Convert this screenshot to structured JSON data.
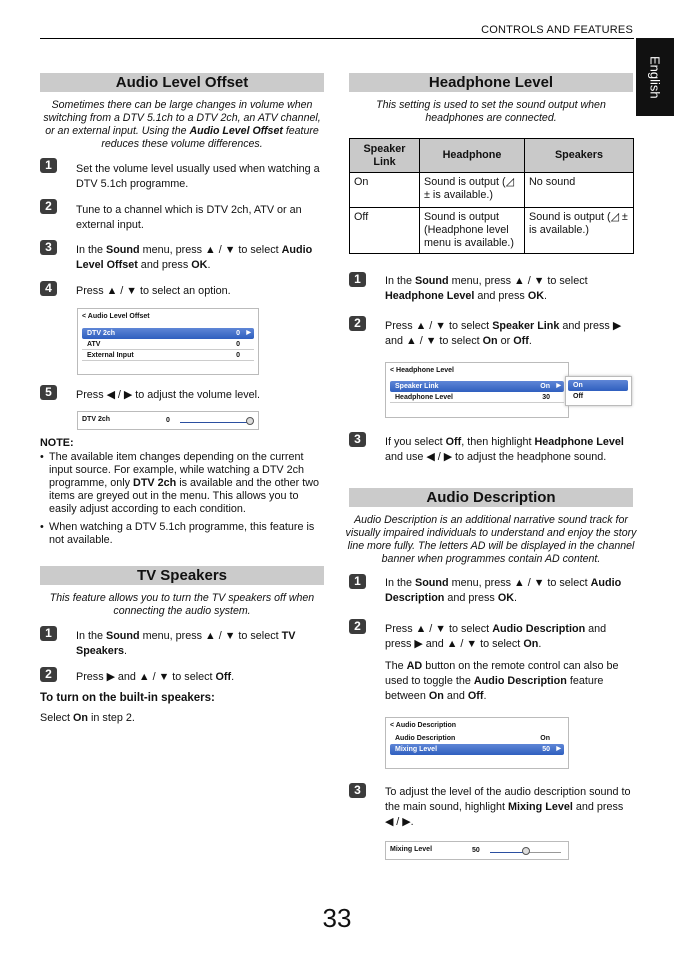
{
  "header": {
    "section": "CONTROLS AND FEATURES",
    "language_tab": "English",
    "page_number": "33"
  },
  "audio_level_offset": {
    "title": "Audio Level Offset",
    "intro": [
      {
        "t": "Sometimes there can be large changes in volume when switching from a DTV 5.1ch to a DTV 2ch, an ATV channel, or an external input. Using the "
      },
      {
        "t": "Audio Level Offset",
        "b": true
      },
      {
        "t": " feature reduces these volume differences."
      }
    ],
    "steps": [
      {
        "n": "1",
        "text": [
          {
            "t": "Set the volume level usually used when watching a DTV 5.1ch programme."
          }
        ]
      },
      {
        "n": "2",
        "text": [
          {
            "t": "Tune to a channel which is DTV 2ch, ATV or an external input."
          }
        ]
      },
      {
        "n": "3",
        "text": [
          {
            "t": "In the "
          },
          {
            "t": "Sound",
            "b": true
          },
          {
            "t": " menu, press ▲ / ▼ to select "
          },
          {
            "t": "Audio Level Offset",
            "b": true
          },
          {
            "t": " and press "
          },
          {
            "t": "OK",
            "b": true
          },
          {
            "t": "."
          }
        ]
      },
      {
        "n": "4",
        "text": [
          {
            "t": "Press ▲ / ▼ to select an option."
          }
        ]
      },
      {
        "n": "5",
        "text": [
          {
            "t": "Press ◀ / ▶ to adjust the volume level."
          }
        ]
      }
    ],
    "menu": {
      "title": "< Audio Level Offset",
      "items": [
        {
          "label": "DTV 2ch",
          "value": "0",
          "selected": true
        },
        {
          "label": "ATV",
          "value": "0"
        },
        {
          "label": "External Input",
          "value": "0"
        }
      ]
    },
    "slider": {
      "label": "DTV 2ch",
      "value": "0",
      "level_percent": 100
    },
    "note_title": "NOTE:",
    "notes": [
      [
        {
          "t": "The available item changes depending on the current input source. For example, while watching a DTV 2ch programme, only "
        },
        {
          "t": "DTV 2ch",
          "b": true
        },
        {
          "t": " is available and the other two items are greyed out in the menu. This allows you to easily adjust according to each condition."
        }
      ],
      [
        {
          "t": "When watching a DTV 5.1ch programme, this feature is not available."
        }
      ]
    ]
  },
  "tv_speakers": {
    "title": "TV Speakers",
    "intro": [
      {
        "t": "This feature allows you to turn the TV speakers off when connecting the audio system."
      }
    ],
    "steps": [
      {
        "n": "1",
        "text": [
          {
            "t": "In the "
          },
          {
            "t": "Sound",
            "b": true
          },
          {
            "t": " menu, press ▲ / ▼ to select "
          },
          {
            "t": "TV Speakers",
            "b": true
          },
          {
            "t": "."
          }
        ]
      },
      {
        "n": "2",
        "text": [
          {
            "t": "Press ▶ and ▲ / ▼ to select "
          },
          {
            "t": "Off",
            "b": true
          },
          {
            "t": "."
          }
        ]
      }
    ],
    "subheading": "To turn on the built-in speakers:",
    "subtext": [
      {
        "t": "Select "
      },
      {
        "t": "On",
        "b": true
      },
      {
        "t": " in step 2."
      }
    ]
  },
  "headphone_level": {
    "title": "Headphone Level",
    "intro": [
      {
        "t": "This setting is used to set the sound output when headphones are connected."
      }
    ],
    "table": {
      "headers": [
        "Speaker Link",
        "Headphone",
        "Speakers"
      ],
      "rows": [
        [
          "On",
          " Sound is output (◿ ± is available.)",
          "No sound"
        ],
        [
          "Off",
          "Sound is output (Headphone level menu is available.)",
          "Sound is output (◿ ± is available.)"
        ]
      ]
    },
    "steps": [
      {
        "n": "1",
        "text": [
          {
            "t": "In the "
          },
          {
            "t": "Sound",
            "b": true
          },
          {
            "t": " menu, press ▲ / ▼ to select "
          },
          {
            "t": "Headphone Level",
            "b": true
          },
          {
            "t": " and press "
          },
          {
            "t": "OK",
            "b": true
          },
          {
            "t": "."
          }
        ]
      },
      {
        "n": "2",
        "text": [
          {
            "t": "Press ▲ / ▼ to select "
          },
          {
            "t": "Speaker Link",
            "b": true
          },
          {
            "t": " and press ▶ and ▲ / ▼ to select "
          },
          {
            "t": "On",
            "b": true
          },
          {
            "t": " or "
          },
          {
            "t": "Off",
            "b": true
          },
          {
            "t": "."
          }
        ]
      },
      {
        "n": "3",
        "text": [
          {
            "t": "If you select "
          },
          {
            "t": "Off",
            "b": true
          },
          {
            "t": ", then highlight "
          },
          {
            "t": "Headphone Level",
            "b": true
          },
          {
            "t": " and use ◀ / ▶ to adjust the headphone sound."
          }
        ]
      }
    ],
    "menu": {
      "title": "< Headphone Level",
      "items": [
        {
          "label": "Speaker Link",
          "value": "On",
          "selected": true
        },
        {
          "label": "Headphone Level",
          "value": "30"
        }
      ],
      "popup": [
        "On",
        "Off"
      ]
    }
  },
  "audio_description": {
    "title": "Audio Description",
    "intro": [
      {
        "t": "Audio Description is an additional narrative sound track for visually impaired individuals to understand and enjoy the story line more fully. The letters AD will be displayed in the channel banner when programmes contain AD content."
      }
    ],
    "steps": [
      {
        "n": "1",
        "text": [
          {
            "t": "In the "
          },
          {
            "t": "Sound",
            "b": true
          },
          {
            "t": " menu, press ▲ / ▼ to select "
          },
          {
            "t": "Audio Description",
            "b": true
          },
          {
            "t": " and press "
          },
          {
            "t": "OK",
            "b": true
          },
          {
            "t": "."
          }
        ]
      },
      {
        "n": "2",
        "text": [
          {
            "t": "Press ▲ / ▼ to select "
          },
          {
            "t": "Audio Description",
            "b": true
          },
          {
            "t": " and press ▶ and ▲ / ▼ to select "
          },
          {
            "t": "On",
            "b": true
          },
          {
            "t": "."
          }
        ]
      },
      {
        "n": "3",
        "text": [
          {
            "t": "To adjust the level of the audio description sound to the main sound, highlight "
          },
          {
            "t": "Mixing Level",
            "b": true
          },
          {
            "t": " and press ◀ / ▶."
          }
        ]
      }
    ],
    "extra": [
      {
        "t": "The "
      },
      {
        "t": "AD",
        "b": true
      },
      {
        "t": " button on the remote control can also be used to toggle the "
      },
      {
        "t": "Audio Description",
        "b": true
      },
      {
        "t": " feature between "
      },
      {
        "t": "On",
        "b": true
      },
      {
        "t": " and "
      },
      {
        "t": "Off",
        "b": true
      },
      {
        "t": "."
      }
    ],
    "menu": {
      "title": "< Audio Description",
      "items": [
        {
          "label": "Audio Description",
          "value": "On"
        },
        {
          "label": "Mixing Level",
          "value": "50",
          "selected": true
        }
      ]
    },
    "slider": {
      "label": "Mixing Level",
      "value": "50",
      "level_percent": 50
    }
  }
}
